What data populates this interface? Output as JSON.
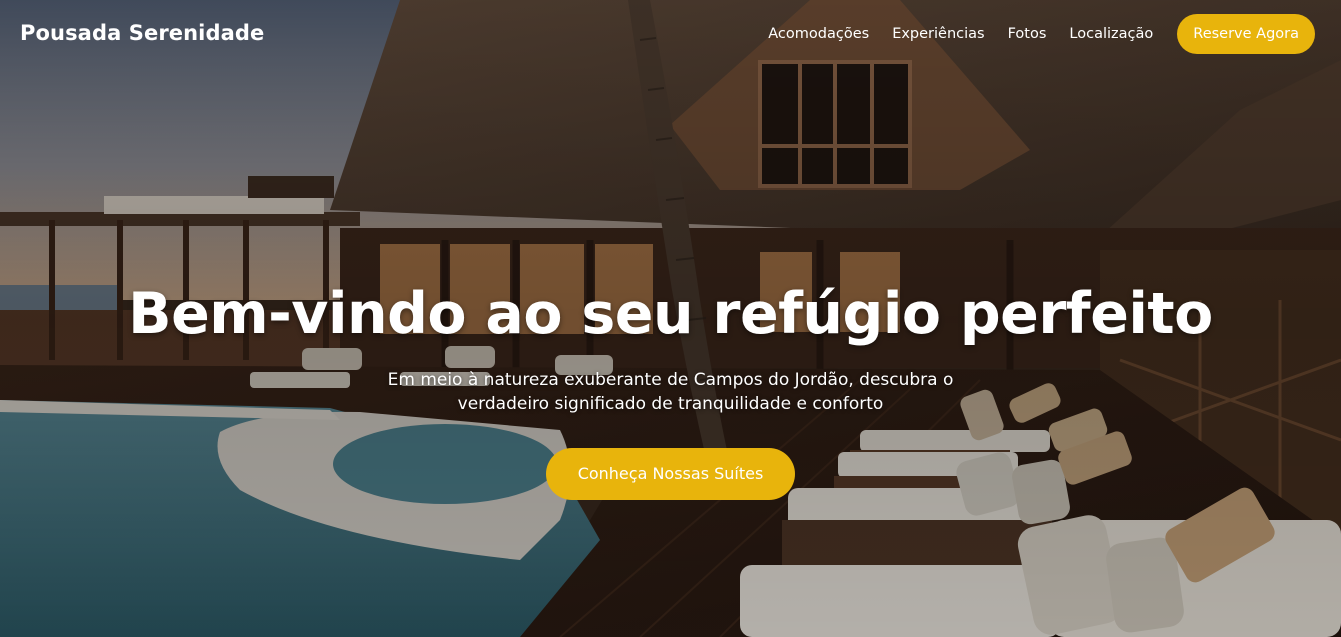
{
  "brand": {
    "name": "Pousada Serenidade"
  },
  "nav": {
    "links": [
      "Acomodações",
      "Experiências",
      "Fotos",
      "Localização"
    ],
    "cta_label": "Reserve Agora"
  },
  "hero": {
    "title": "Bem-vindo ao seu refúgio perfeito",
    "subtitle": "Em meio à natureza exuberante de Campos do Jordão, descubra o verdadeiro significado de tranquilidade e conforto",
    "cta_label": "Conheça Nossas Suítes"
  },
  "colors": {
    "accent": "#e8b40c",
    "text": "#ffffff"
  }
}
